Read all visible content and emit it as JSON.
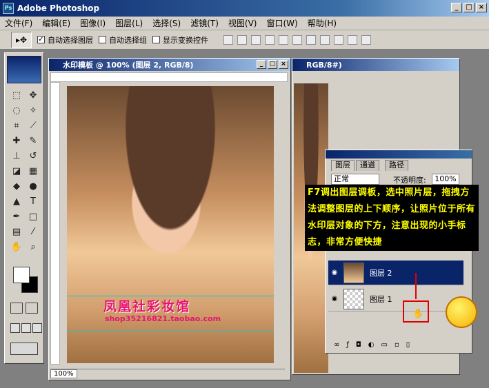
{
  "app": {
    "title": "Adobe Photoshop",
    "ps_badge": "Ps"
  },
  "menu": [
    "文件(F)",
    "编辑(E)",
    "图像(I)",
    "图层(L)",
    "选择(S)",
    "滤镜(T)",
    "视图(V)",
    "窗口(W)",
    "帮助(H)"
  ],
  "options": {
    "auto_select_layer": "自动选择图层",
    "auto_select_group": "自动选择组",
    "show_transform": "显示变换控件",
    "checked_mark": "✓"
  },
  "doc1": {
    "title": "水印模板 @ 100% (图层 2, RGB/8)",
    "zoom": "100%"
  },
  "doc2": {
    "title": "RGB/8#)"
  },
  "watermark": {
    "title": "凤凰社彩妆馆",
    "url": "shop35216821.taobao.com"
  },
  "layers_panel": {
    "tabs": [
      "图层",
      "通道",
      "路径"
    ],
    "blend_mode": "正常",
    "opacity_label": "不透明度:",
    "opacity_value": "100%",
    "rows": [
      {
        "name": "图层 2",
        "selected": true
      },
      {
        "name": "图层 1",
        "selected": false
      }
    ]
  },
  "annotation": "F7调出图层调板，选中照片层，拖拽方法调整图层的上下顺序，让照片位于所有水印层对象的下方，注意出现的小手标志，非常方便快捷",
  "colors": {
    "accent": "#0a246a",
    "annotation_text": "#ffff00",
    "watermark": "#e8146e",
    "highlight_box": "#e00000"
  }
}
